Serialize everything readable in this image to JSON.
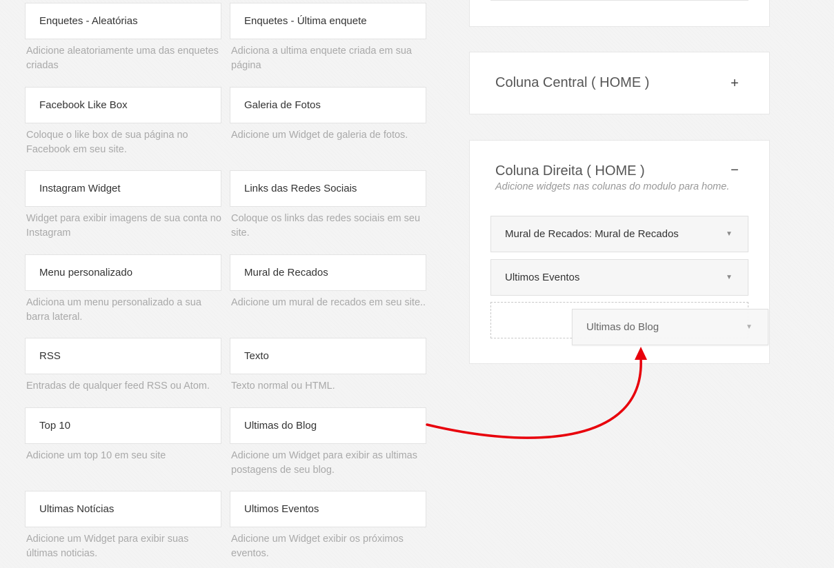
{
  "available_widgets": [
    {
      "title": "Enquetes - Aleatórias",
      "description": "Adicione aleatoriamente uma das enquetes criadas"
    },
    {
      "title": "Enquetes - Última enquete",
      "description": "Adiciona a ultima enquete criada em sua página"
    },
    {
      "title": "Facebook Like Box",
      "description": "Coloque o like box de sua página no Facebook em seu site."
    },
    {
      "title": "Galeria de Fotos",
      "description": "Adicione um Widget de galeria de fotos."
    },
    {
      "title": "Instagram Widget",
      "description": "Widget para exibir imagens de sua conta no Instagram"
    },
    {
      "title": "Links das Redes Sociais",
      "description": "Coloque os links das redes sociais em seu site."
    },
    {
      "title": "Menu personalizado",
      "description": "Adiciona um menu personalizado a sua barra lateral."
    },
    {
      "title": "Mural de Recados",
      "description": "Adicione um mural de recados em seu site.."
    },
    {
      "title": "RSS",
      "description": "Entradas de qualquer feed RSS ou Atom."
    },
    {
      "title": "Texto",
      "description": "Texto normal ou HTML."
    },
    {
      "title": "Top 10",
      "description": "Adicione um top 10 em seu site"
    },
    {
      "title": "Ultimas do Blog",
      "description": "Adicione um Widget para exibir as ultimas postagens de seu blog."
    },
    {
      "title": "Ultimas Notícias",
      "description": "Adicione um Widget para exibir suas últimas noticias."
    },
    {
      "title": "Ultimos Eventos",
      "description": "Adicione um Widget exibir os próximos eventos."
    }
  ],
  "sidebars": {
    "central": {
      "title": "Coluna Central ( HOME )",
      "toggle": "+"
    },
    "direita": {
      "title": "Coluna Direita ( HOME )",
      "toggle": "−",
      "description": "Adicione widgets nas colunas do modulo para home.",
      "widgets": [
        {
          "title": "Mural de Recados: Mural de Recados"
        },
        {
          "title": "Ultimos Eventos"
        }
      ]
    }
  },
  "dragging_widget": {
    "title": "Ultimas do Blog"
  },
  "annotation": {
    "arrow_color": "#e8000b"
  },
  "icons": {
    "widget_caret": "caret-down-icon"
  }
}
